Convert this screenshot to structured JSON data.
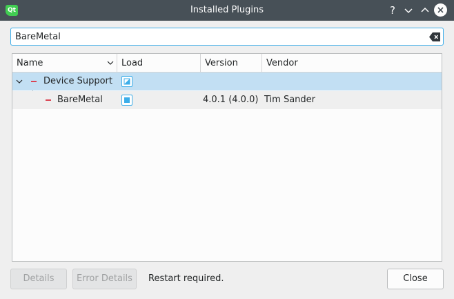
{
  "window": {
    "title": "Installed Plugins",
    "app_icon_text": "Qt",
    "help_glyph": "?",
    "minimize_glyph": "⌄",
    "maximize_glyph": "⌃"
  },
  "search": {
    "value": "BareMetal"
  },
  "tree": {
    "columns": [
      "Name",
      "Load",
      "Version",
      "Vendor"
    ],
    "rows": [
      {
        "name": "Device Support",
        "load": "partial",
        "version": "",
        "vendor": "",
        "expanded": true,
        "selected": true
      },
      {
        "name": "BareMetal",
        "load": "checked",
        "version": "4.0.1 (4.0.0)",
        "vendor": "Tim Sander",
        "expanded": false,
        "selected": false
      }
    ]
  },
  "footer": {
    "details_label": "Details",
    "error_details_label": "Error Details",
    "status_text": "Restart required.",
    "close_label": "Close"
  },
  "colors": {
    "accent": "#3daee9",
    "selection": "#c2dff3",
    "titlebar": "#475057",
    "error_dash": "#da4453"
  }
}
